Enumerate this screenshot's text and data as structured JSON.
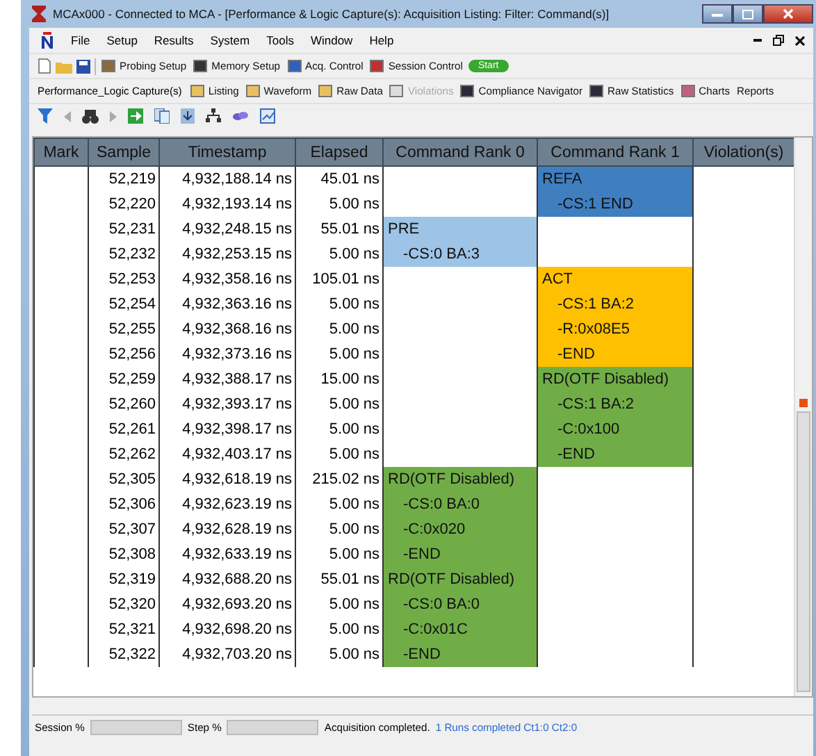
{
  "window": {
    "title": "MCAx000 - Connected to MCA - [Performance & Logic Capture(s): Acquisition Listing: Filter: Command(s)]"
  },
  "menu": [
    "File",
    "Setup",
    "Results",
    "System",
    "Tools",
    "Window",
    "Help"
  ],
  "toolbar_1": [
    {
      "label": "Probing Setup",
      "kind": "probe"
    },
    {
      "label": "Memory Setup",
      "kind": "memory"
    },
    {
      "label": "Acq. Control",
      "kind": "acq"
    },
    {
      "label": "Session Control",
      "kind": "session"
    }
  ],
  "start_button": "Start",
  "toolbar_2": {
    "title": "Performance_Logic Capture(s)",
    "items": [
      {
        "label": "Listing",
        "disabled": false,
        "kind": "panel"
      },
      {
        "label": "Waveform",
        "disabled": false,
        "kind": "panel"
      },
      {
        "label": "Raw Data",
        "disabled": false,
        "kind": "panel"
      },
      {
        "label": "Violations",
        "disabled": true,
        "kind": "panel"
      },
      {
        "label": "Compliance Navigator",
        "disabled": false,
        "kind": "dark"
      },
      {
        "label": "Raw Statistics",
        "disabled": false,
        "kind": "dark"
      },
      {
        "label": "Charts",
        "disabled": false,
        "kind": "chart"
      },
      {
        "label": "Reports",
        "disabled": false,
        "kind": "none"
      }
    ]
  },
  "table": {
    "columns": [
      "Mark",
      "Sample",
      "Timestamp",
      "Elapsed",
      "Command Rank 0",
      "Command Rank 1",
      "Violation(s)"
    ],
    "rows": [
      {
        "sample": "52,219",
        "timestamp": "4,932,188.14 ns",
        "elapsed": "45.01 ns",
        "rank_1": {
          "text": "REFA",
          "color": "#3f7fc0"
        }
      },
      {
        "sample": "52,220",
        "timestamp": "4,932,193.14 ns",
        "elapsed": "5.00 ns",
        "rank_1": {
          "text": "-CS:1 END",
          "color": "#3f7fc0"
        }
      },
      {
        "sample": "52,231",
        "timestamp": "4,932,248.15 ns",
        "elapsed": "55.01 ns",
        "rank_0": {
          "text": "PRE",
          "color": "#9dc3e6"
        }
      },
      {
        "sample": "52,232",
        "timestamp": "4,932,253.15 ns",
        "elapsed": "5.00 ns",
        "rank_0": {
          "text": "-CS:0 BA:3",
          "color": "#9dc3e6"
        }
      },
      {
        "sample": "52,253",
        "timestamp": "4,932,358.16 ns",
        "elapsed": "105.01 ns",
        "rank_1": {
          "text": "ACT",
          "color": "#ffc000"
        }
      },
      {
        "sample": "52,254",
        "timestamp": "4,932,363.16 ns",
        "elapsed": "5.00 ns",
        "rank_1": {
          "text": "-CS:1 BA:2",
          "color": "#ffc000"
        }
      },
      {
        "sample": "52,255",
        "timestamp": "4,932,368.16 ns",
        "elapsed": "5.00 ns",
        "rank_1": {
          "text": "-R:0x08E5",
          "color": "#ffc000"
        }
      },
      {
        "sample": "52,256",
        "timestamp": "4,932,373.16 ns",
        "elapsed": "5.00 ns",
        "rank_1": {
          "text": "-END",
          "color": "#ffc000"
        }
      },
      {
        "sample": "52,259",
        "timestamp": "4,932,388.17 ns",
        "elapsed": "15.00 ns",
        "rank_1": {
          "text": "RD(OTF Disabled)",
          "color": "#70ad47"
        }
      },
      {
        "sample": "52,260",
        "timestamp": "4,932,393.17 ns",
        "elapsed": "5.00 ns",
        "rank_1": {
          "text": "-CS:1 BA:2",
          "color": "#70ad47"
        }
      },
      {
        "sample": "52,261",
        "timestamp": "4,932,398.17 ns",
        "elapsed": "5.00 ns",
        "rank_1": {
          "text": "-C:0x100",
          "color": "#70ad47"
        }
      },
      {
        "sample": "52,262",
        "timestamp": "4,932,403.17 ns",
        "elapsed": "5.00 ns",
        "rank_1": {
          "text": "-END",
          "color": "#70ad47"
        }
      },
      {
        "sample": "52,305",
        "timestamp": "4,932,618.19 ns",
        "elapsed": "215.02 ns",
        "rank_0": {
          "text": "RD(OTF Disabled)",
          "color": "#70ad47"
        }
      },
      {
        "sample": "52,306",
        "timestamp": "4,932,623.19 ns",
        "elapsed": "5.00 ns",
        "rank_0": {
          "text": "-CS:0 BA:0",
          "color": "#70ad47"
        }
      },
      {
        "sample": "52,307",
        "timestamp": "4,932,628.19 ns",
        "elapsed": "5.00 ns",
        "rank_0": {
          "text": "-C:0x020",
          "color": "#70ad47"
        }
      },
      {
        "sample": "52,308",
        "timestamp": "4,932,633.19 ns",
        "elapsed": "5.00 ns",
        "rank_0": {
          "text": "-END",
          "color": "#70ad47"
        }
      },
      {
        "sample": "52,319",
        "timestamp": "4,932,688.20 ns",
        "elapsed": "55.01 ns",
        "rank_0": {
          "text": "RD(OTF Disabled)",
          "color": "#70ad47"
        }
      },
      {
        "sample": "52,320",
        "timestamp": "4,932,693.20 ns",
        "elapsed": "5.00 ns",
        "rank_0": {
          "text": "-CS:0 BA:0",
          "color": "#70ad47"
        }
      },
      {
        "sample": "52,321",
        "timestamp": "4,932,698.20 ns",
        "elapsed": "5.00 ns",
        "rank_0": {
          "text": "-C:0x01C",
          "color": "#70ad47"
        }
      },
      {
        "sample": "52,322",
        "timestamp": "4,932,703.20 ns",
        "elapsed": "5.00 ns",
        "rank_0": {
          "text": "-END",
          "color": "#70ad47"
        }
      }
    ]
  },
  "status_bar": {
    "session_label": "Session %",
    "session_progress": {
      "level": 0
    },
    "step_label": "Step %",
    "step_progress": {
      "level": 0
    },
    "message": "Acquisition completed.",
    "runs": "1 Runs completed Ct1:0 Ct2:0"
  }
}
